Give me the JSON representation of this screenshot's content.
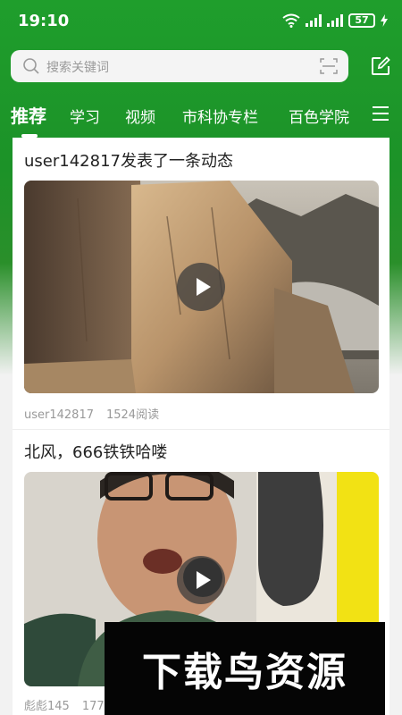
{
  "status_bar": {
    "time": "19:10",
    "battery": "57"
  },
  "search": {
    "placeholder": "搜索关键词"
  },
  "tabs": [
    {
      "label": "推荐",
      "active": true
    },
    {
      "label": "学习"
    },
    {
      "label": "视频"
    },
    {
      "label": "市科协专栏"
    },
    {
      "label": "百色学院"
    }
  ],
  "posts": [
    {
      "title": "user142817发表了一条动态",
      "author": "user142817",
      "reads": "1524阅读"
    },
    {
      "title": "北风，666铁铁哈喽",
      "author": "彪彪145",
      "reads": "177阅读"
    }
  ],
  "watermark": {
    "text": "下载鸟资源"
  },
  "colors": {
    "brand_green": "#1f9e2c"
  },
  "icons": [
    "wifi-icon",
    "signal-icon",
    "battery-icon",
    "charging-icon",
    "search-icon",
    "scan-icon",
    "edit-icon",
    "menu-icon",
    "play-icon"
  ]
}
